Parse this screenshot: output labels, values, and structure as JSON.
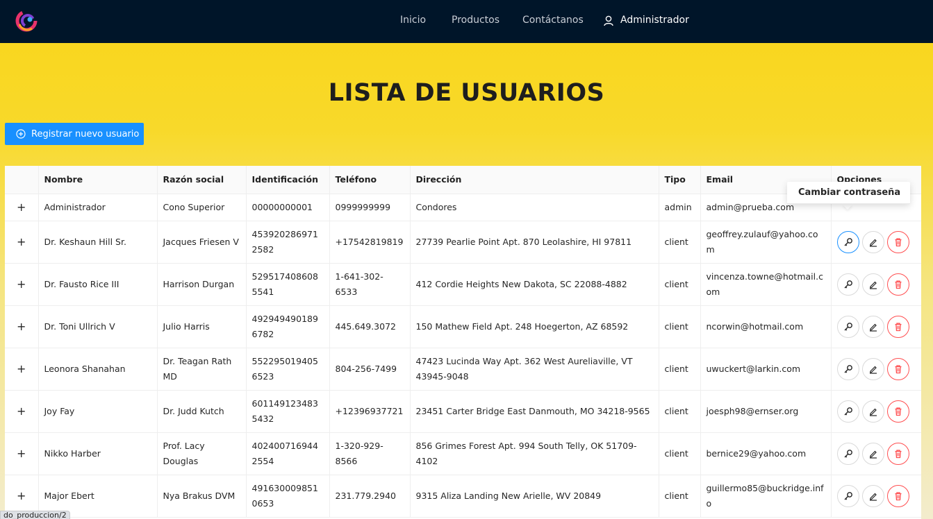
{
  "nav": {
    "links": [
      "Inicio",
      "Productos",
      "Contáctanos"
    ],
    "user_label": "Administrador"
  },
  "page_title": "LISTA DE USUARIOS",
  "register_button": "Registrar nuevo usuario",
  "table": {
    "headers": [
      "Nombre",
      "Razón social",
      "Identificación",
      "Teléfono",
      "Dirección",
      "Tipo",
      "Email",
      "Opciones"
    ],
    "expand_symbol": "+",
    "rows": [
      {
        "nombre": "Administrador",
        "razon": "Cono Superior",
        "id": "00000000001",
        "telefono": "0999999999",
        "direccion": "Condores",
        "tipo": "admin",
        "email": "admin@prueba.com"
      },
      {
        "nombre": "Dr. Keshaun Hill Sr.",
        "razon": "Jacques Friesen V",
        "id": "4539202869712582",
        "telefono": "+17542819819",
        "direccion": "27739 Pearlie Point Apt. 870 Leolashire, HI 97811",
        "tipo": "client",
        "email": "geoffrey.zulauf@yahoo.com"
      },
      {
        "nombre": "Dr. Fausto Rice III",
        "razon": "Harrison Durgan",
        "id": "5295174086085541",
        "telefono": "1-641-302-6533",
        "direccion": "412 Cordie Heights New Dakota, SC 22088-4882",
        "tipo": "client",
        "email": "vincenza.towne@hotmail.com"
      },
      {
        "nombre": "Dr. Toni Ullrich V",
        "razon": "Julio Harris",
        "id": "4929494901896782",
        "telefono": "445.649.3072",
        "direccion": "150 Mathew Field Apt. 248 Hoegerton, AZ 68592",
        "tipo": "client",
        "email": "ncorwin@hotmail.com"
      },
      {
        "nombre": "Leonora Shanahan",
        "razon": "Dr. Teagan Rath MD",
        "id": "5522950194056523",
        "telefono": "804-256-7499",
        "direccion": "47423 Lucinda Way Apt. 362 West Aureliaville, VT 43945-9048",
        "tipo": "client",
        "email": "uwuckert@larkin.com"
      },
      {
        "nombre": "Joy Fay",
        "razon": "Dr. Judd Kutch",
        "id": "6011491234835432",
        "telefono": "+12396937721",
        "direccion": "23451 Carter Bridge East Danmouth, MO 34218-9565",
        "tipo": "client",
        "email": "joesph98@ernser.org"
      },
      {
        "nombre": "Nikko Harber",
        "razon": "Prof. Lacy Douglas",
        "id": "4024007169442554",
        "telefono": "1-320-929-8566",
        "direccion": "856 Grimes Forest Apt. 994 South Telly, OK 51709-4102",
        "tipo": "client",
        "email": "bernice29@yahoo.com"
      },
      {
        "nombre": "Major Ebert",
        "razon": "Nya Brakus DVM",
        "id": "4916300098510653",
        "telefono": "231.779.2940",
        "direccion": "9315 Aliza Landing New Arielle, WV 20849",
        "tipo": "client",
        "email": "guillermo85@buckridge.info"
      }
    ]
  },
  "popover": {
    "item": "Cambiar contraseña"
  },
  "status_url": "do_produccion/2",
  "colors": {
    "navbar": "#001529",
    "primary": "#1890ff",
    "danger": "#ff4d4f",
    "accent": "#fad51a"
  }
}
